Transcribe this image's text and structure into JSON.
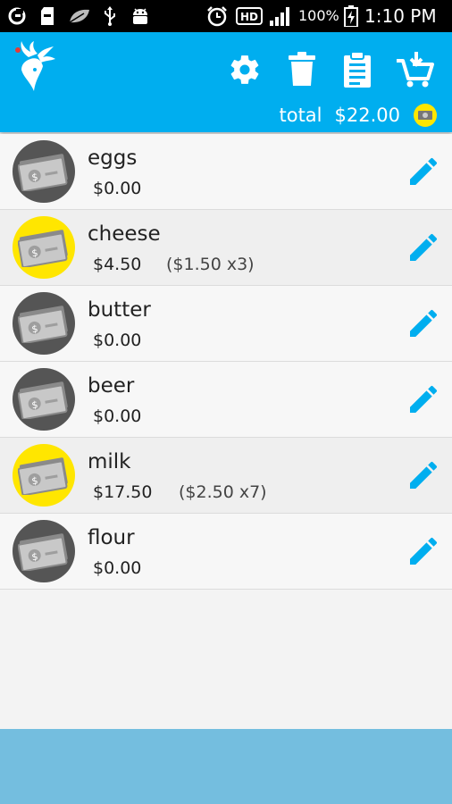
{
  "status_bar": {
    "battery_percent": "100%",
    "time": "1:10 PM",
    "icons": [
      "carrier-icon",
      "sd-card-icon",
      "leaf-icon",
      "usb-icon",
      "android-icon",
      "alarm-icon",
      "hd-icon",
      "signal-icon",
      "battery-charging-icon"
    ]
  },
  "app_bar": {
    "logo": "deer-logo",
    "actions": [
      "settings-icon",
      "delete-icon",
      "clipboard-icon",
      "cart-add-icon"
    ],
    "total_label": "total",
    "total_value": "$22.00",
    "colors": {
      "primary": "#00aeef",
      "bottom_bar": "#74bedf"
    }
  },
  "items": [
    {
      "name": "eggs",
      "price": "$0.00",
      "detail": "",
      "status": "gray"
    },
    {
      "name": "cheese",
      "price": "$4.50",
      "detail": "($1.50 x3)",
      "status": "yellow"
    },
    {
      "name": "butter",
      "price": "$0.00",
      "detail": "",
      "status": "gray"
    },
    {
      "name": "beer",
      "price": "$0.00",
      "detail": "",
      "status": "gray"
    },
    {
      "name": "milk",
      "price": "$17.50",
      "detail": "($2.50 x7)",
      "status": "yellow"
    },
    {
      "name": "flour",
      "price": "$0.00",
      "detail": "",
      "status": "gray"
    }
  ]
}
